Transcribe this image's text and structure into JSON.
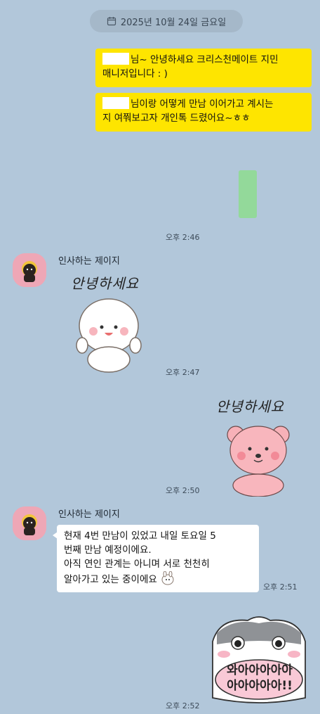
{
  "date_divider": {
    "label": "2025년 10월 24일 금요일",
    "icon": "calendar-icon"
  },
  "messages": {
    "m1": {
      "name_suffix": "님~ 안녕하세요 크리스천메이트 지민",
      "line2": "매니저입니다 : )"
    },
    "m2": {
      "name_suffix": "님이랑 어떻게 만남 이어가고 계시는",
      "line2": "지 여쭤보고자 개인톡 드렸어요~ㅎㅎ"
    },
    "t1": "오후 2:46",
    "sender1": "인사하는 제이지",
    "sticker1": {
      "caption": "안녕하세요",
      "time": "오후 2:47"
    },
    "sticker2": {
      "caption": "안녕하세요",
      "time": "오후 2:50"
    },
    "sender2": "인사하는 제이지",
    "reply": {
      "line1": "현재 4번 만남이 있었고 내일 토요일 5",
      "line2": "번째 만남 예정이에요.",
      "line3": "아직 연인 관계는 아니며 서로 천천히",
      "line4": "알아가고 있는 중이에요",
      "time": "오후 2:51"
    },
    "sticker3": {
      "caption": "와아아아아아 아아아아아!!",
      "time": "오후 2:52"
    }
  },
  "colors": {
    "background": "#b2c7da",
    "my_bubble": "#fee500",
    "their_bubble": "#ffffff",
    "avatar_bg": "#eea7b6",
    "green_attachment": "#93d99a"
  }
}
